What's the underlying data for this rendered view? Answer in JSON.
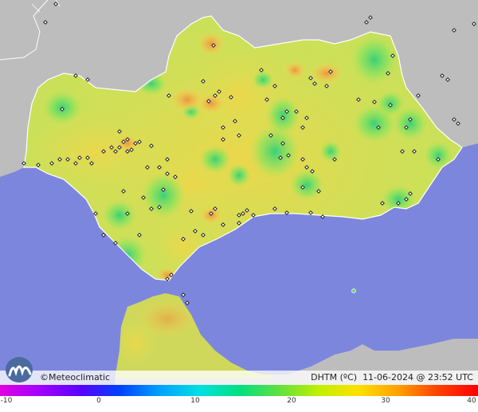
{
  "brand": {
    "copyright_symbol": "©",
    "name": "Meteoclimatic"
  },
  "info": {
    "variable": "DHTM (ºC)",
    "datetime": "11-06-2024 @ 23:52 UTC"
  },
  "scale": {
    "ticks": [
      "-10",
      "0",
      "10",
      "20",
      "30",
      "40"
    ],
    "colors": [
      "#e000e0",
      "#a000ff",
      "#5a00ff",
      "#0040ff",
      "#00a0ff",
      "#00e0e0",
      "#00e080",
      "#60e040",
      "#c0f000",
      "#ffe000",
      "#ffa000",
      "#ff4000",
      "#ff0000"
    ]
  },
  "palette": {
    "sea": "#7d86dd",
    "land_outside": "#b9b9b9",
    "land_base": "#c2e05a",
    "warm": "#f2a64d",
    "cool": "#57d96a",
    "station": "#111111"
  }
}
